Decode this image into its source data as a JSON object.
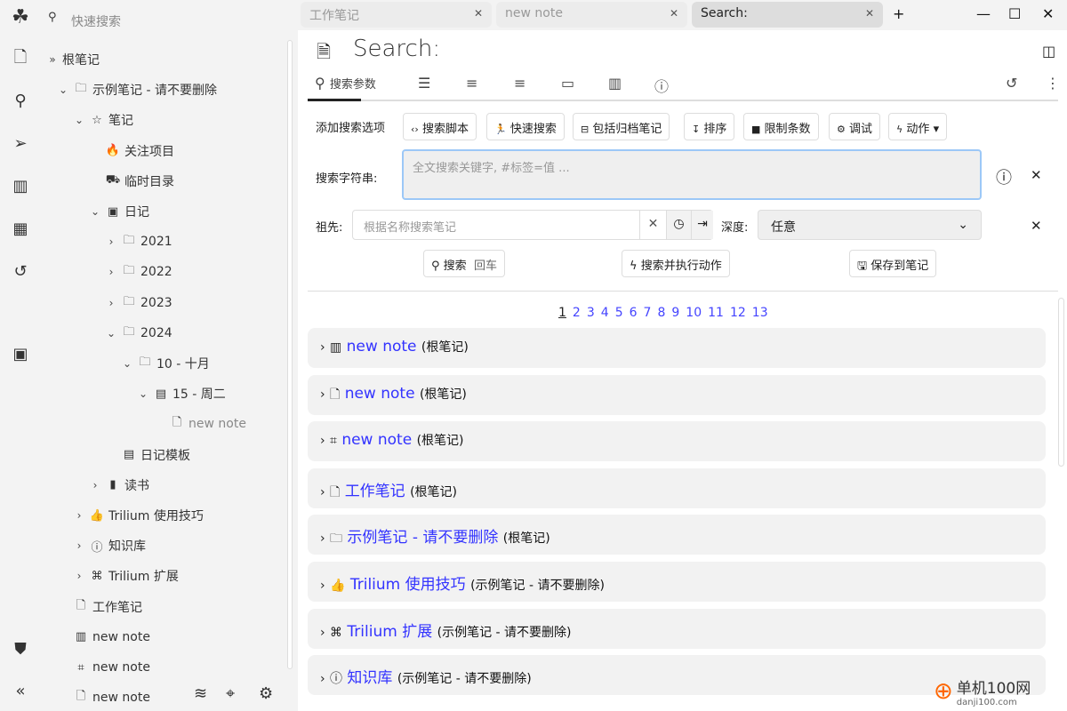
{
  "quick_search": {
    "placeholder": "快速搜索"
  },
  "tree": [
    {
      "label": "根笔记",
      "icon": "double-chevron",
      "chev": "",
      "lvl": 0
    },
    {
      "label": "示例笔记 - 请不要删除",
      "icon": "folder",
      "chev": "open",
      "lvl": 1
    },
    {
      "label": "笔记",
      "icon": "star",
      "chev": "open",
      "lvl": 2
    },
    {
      "label": "关注项目",
      "icon": "fire",
      "chev": "",
      "lvl": 3
    },
    {
      "label": "临时目录",
      "icon": "truck",
      "chev": "",
      "lvl": 3
    },
    {
      "label": "日记",
      "icon": "journal",
      "chev": "open",
      "lvl": 3
    },
    {
      "label": "2021",
      "icon": "folder",
      "chev": "closed",
      "lvl": 4
    },
    {
      "label": "2022",
      "icon": "folder",
      "chev": "closed",
      "lvl": 4
    },
    {
      "label": "2023",
      "icon": "folder",
      "chev": "closed",
      "lvl": 4
    },
    {
      "label": "2024",
      "icon": "folder",
      "chev": "open",
      "lvl": 4
    },
    {
      "label": "10 - 十月",
      "icon": "folder",
      "chev": "open",
      "lvl": 5
    },
    {
      "label": "15 - 周二",
      "icon": "calendar",
      "chev": "open",
      "lvl": 6
    },
    {
      "label": "new note",
      "icon": "note",
      "chev": "",
      "lvl": 7,
      "muted": true
    },
    {
      "label": "日记模板",
      "icon": "calendar",
      "chev": "",
      "lvl": 4
    },
    {
      "label": "读书",
      "icon": "book",
      "chev": "closed",
      "lvl": 3
    },
    {
      "label": "Trilium 使用技巧",
      "icon": "thumbs-up",
      "chev": "closed",
      "lvl": 2
    },
    {
      "label": "知识库",
      "icon": "info",
      "chev": "closed",
      "lvl": 2
    },
    {
      "label": "Trilium 扩展",
      "icon": "command",
      "chev": "closed",
      "lvl": 2
    },
    {
      "label": "工作笔记",
      "icon": "note",
      "chev": "",
      "lvl": 1
    },
    {
      "label": "new note",
      "icon": "map",
      "chev": "",
      "lvl": 1
    },
    {
      "label": "new note",
      "icon": "network",
      "chev": "",
      "lvl": 1
    },
    {
      "label": "new note",
      "icon": "note",
      "chev": "",
      "lvl": 1
    }
  ],
  "tabs": [
    {
      "label": "工作笔记"
    },
    {
      "label": "new note"
    },
    {
      "label": "Search:",
      "active": true
    }
  ],
  "note_title": "Search:",
  "ribbon": {
    "search_params": "搜索参数"
  },
  "options": {
    "label": "添加搜索选项",
    "buttons": [
      "搜索脚本",
      "快速搜索",
      "包括归档笔记",
      "排序",
      "限制条数",
      "调试",
      "动作"
    ]
  },
  "search_string": {
    "label": "搜索字符串:",
    "placeholder": "全文搜索关键字, #标签=值 ..."
  },
  "ancestor": {
    "label": "祖先:",
    "placeholder": "根据名称搜索笔记"
  },
  "depth": {
    "label": "深度:",
    "value": "任意"
  },
  "actions": {
    "search": "搜索",
    "enter": "回车",
    "search_execute": "搜索并执行动作",
    "save": "保存到笔记"
  },
  "pagination": {
    "current": 1,
    "pages": [
      "1",
      "2",
      "3",
      "4",
      "5",
      "6",
      "7",
      "8",
      "9",
      "10",
      "11",
      "12",
      "13"
    ]
  },
  "results": [
    {
      "title": "new note",
      "parent": "(根笔记)",
      "icon": "map"
    },
    {
      "title": "new note",
      "parent": "(根笔记)",
      "icon": "note"
    },
    {
      "title": "new note",
      "parent": "(根笔记)",
      "icon": "network"
    },
    {
      "title": "工作笔记",
      "parent": "(根笔记)",
      "icon": "note"
    },
    {
      "title": "示例笔记 - 请不要删除",
      "parent": "(根笔记)",
      "icon": "folder"
    },
    {
      "title": "Trilium 使用技巧",
      "parent": "(示例笔记 - 请不要删除)",
      "icon": "thumbs-up"
    },
    {
      "title": "Trilium 扩展",
      "parent": "(示例笔记 - 请不要删除)",
      "icon": "command"
    },
    {
      "title": "知识库",
      "parent": "(示例笔记 - 请不要删除)",
      "icon": "info"
    }
  ],
  "watermark": {
    "text": "单机100网",
    "sub": "danji100.com"
  }
}
